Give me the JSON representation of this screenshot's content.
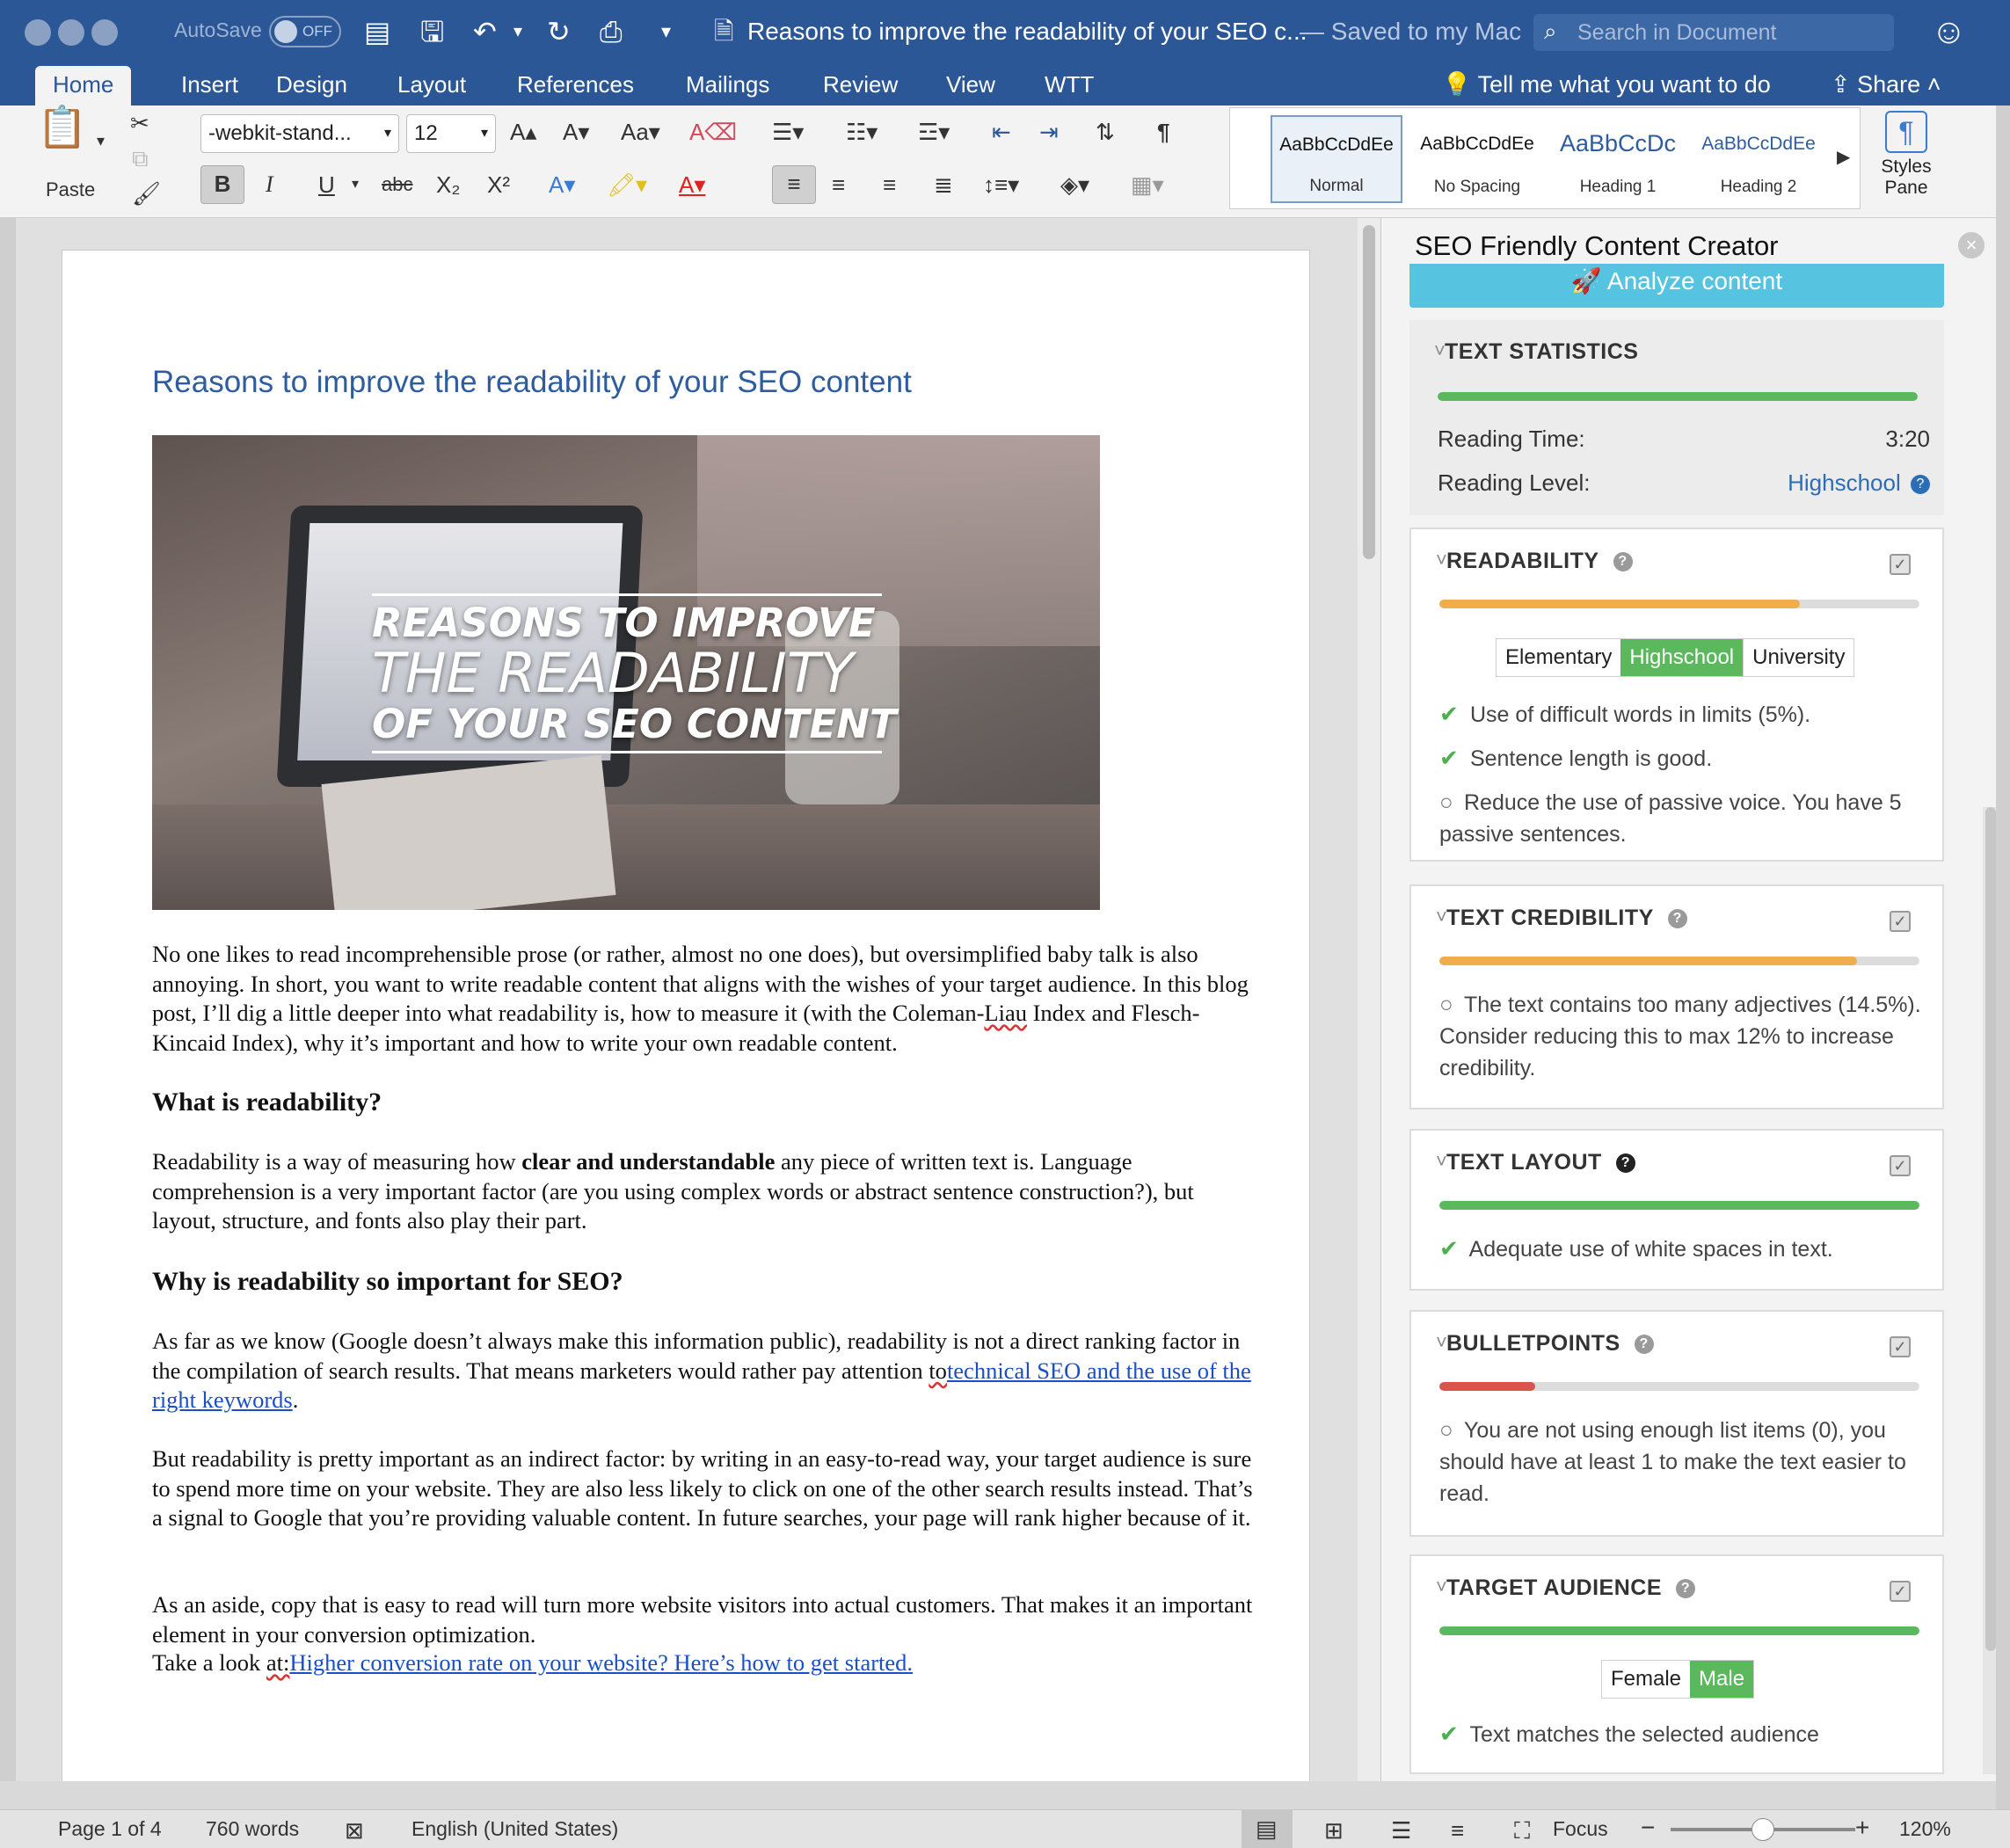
{
  "titlebar": {
    "autosave_label": "AutoSave",
    "autosave_state": "OFF",
    "doc_title": "Reasons to improve the readability of your SEO c...",
    "saved_status": "— Saved to my Mac",
    "search_placeholder": "Search in Document"
  },
  "tabs": [
    "Home",
    "Insert",
    "Design",
    "Layout",
    "References",
    "Mailings",
    "Review",
    "View",
    "WTT"
  ],
  "tell_me": "Tell me what you want to do",
  "share_label": "Share",
  "ribbon": {
    "paste_label": "Paste",
    "font_name": "-webkit-stand...",
    "font_size": "12",
    "bold": "B",
    "italic": "I",
    "underline": "U",
    "strikethrough": "abc",
    "subscript": "X₂",
    "superscript": "X²",
    "styles": [
      {
        "sample": "AaBbCcDdEe",
        "name": "Normal"
      },
      {
        "sample": "AaBbCcDdEe",
        "name": "No Spacing"
      },
      {
        "sample": "AaBbCcDc",
        "name": "Heading 1"
      },
      {
        "sample": "AaBbCcDdEe",
        "name": "Heading 2"
      }
    ],
    "styles_pane_label": "Styles Pane"
  },
  "document": {
    "heading": "Reasons to improve the readability of your SEO content",
    "hero": {
      "line1": "REASONS TO IMPROVE",
      "line2": "THE READABILITY",
      "line3": "OF YOUR SEO CONTENT"
    },
    "p1_a": "No one likes to read incomprehensible prose (or rather, almost no one does), but oversimplified baby talk is also annoying. In short, you want to write readable content that aligns with the wishes of your target audience. In this blog post, I’ll dig a little deeper into what readability is, how to measure it (with the Coleman-",
    "p1_squig": "Liau",
    "p1_b": " Index and Flesch-Kincaid Index), why it’s important and how to write your own readable content.",
    "h_what": "What is readability?",
    "p2_a": "Readability is a way of measuring how ",
    "p2_bold": "clear and understandable",
    "p2_b": " any piece of written text is. Language comprehension is a very important factor (are you using complex words or abstract sentence construction?), but layout, structure, and fonts also play their part.",
    "h_why": "Why is readability so important for SEO?",
    "p3_a": "As far as we know (Google doesn’t always make this information public), readability is not a direct ranking factor in the compilation of search results. That means marketers would rather pay attention ",
    "p3_squig": "to",
    "p3_link": "technical SEO and the use of the right keywords",
    "p3_end": ".",
    "p4": "But readability is pretty important as an indirect factor: by writing in an easy-to-read way, your target audience is sure to spend more time on your website. They are also less likely to click on one of the other search results instead. That’s a signal to Google that you’re providing valuable content. In future searches, your page will rank higher because of it.",
    "p5": "As an aside, copy that is easy to read will turn more website visitors into actual customers. That makes it an important element in your conversion optimization.",
    "p6_a": "Take a look ",
    "p6_squig": "at:",
    "p6_link": "Higher conversion rate on your website? Here’s how to get started."
  },
  "pane": {
    "title": "SEO Friendly Content Creator",
    "analyze_label": "Analyze content",
    "stats": {
      "header": "TEXT STATISTICS",
      "bar_fill": 1.0,
      "reading_time_label": "Reading Time:",
      "reading_time_value": "3:20",
      "reading_level_label": "Reading Level:",
      "reading_level_value": "Highschool"
    },
    "readability": {
      "header": "READABILITY",
      "bar_fill": 0.75,
      "levels": [
        "Elementary",
        "Highschool",
        "University"
      ],
      "selected_level": "Highschool",
      "items": [
        {
          "status": "ok",
          "text": "Use of difficult words in limits (5%)."
        },
        {
          "status": "ok",
          "text": "Sentence length is good."
        },
        {
          "status": "todo",
          "text": "Reduce the use of passive voice. You have 5 passive sentences."
        }
      ]
    },
    "credibility": {
      "header": "TEXT CREDIBILITY",
      "bar_fill": 0.87,
      "items": [
        {
          "status": "todo",
          "text": "The text contains too many adjectives (14.5%). Consider reducing this to max 12% to increase credibility."
        }
      ]
    },
    "layout": {
      "header": "TEXT LAYOUT",
      "bar_fill": 1.0,
      "items": [
        {
          "status": "ok",
          "text": "Adequate use of white spaces in text."
        }
      ]
    },
    "bulletpoints": {
      "header": "BULLETPOINTS",
      "bar_fill": 0.2,
      "items": [
        {
          "status": "todo",
          "text": "You are not using enough list items (0), you should have at least 1 to make the text easier to read."
        }
      ]
    },
    "audience": {
      "header": "TARGET AUDIENCE",
      "bar_fill": 1.0,
      "options": [
        "Female",
        "Male"
      ],
      "selected": "Male",
      "items": [
        {
          "status": "ok",
          "text": "Text matches the selected audience"
        }
      ]
    }
  },
  "statusbar": {
    "page": "Page 1 of 4",
    "words": "760 words",
    "language": "English (United States)",
    "focus_label": "Focus",
    "zoom": "120%",
    "zoom_fraction": 0.5
  },
  "colors": {
    "title_blue": "#2b5797",
    "good_green": "#5cb85c",
    "warn_orange": "#f0ad4e",
    "bad_red": "#d9534f",
    "analyze_cyan": "#56c4e1",
    "link_blue": "#1a4fc8"
  },
  "icons": {
    "save": "save-icon",
    "undo": "undo-icon",
    "redo": "redo-icon",
    "print": "print-icon",
    "search": "search-icon",
    "lightbulb": "lightbulb-icon",
    "share": "share-icon",
    "rocket": "rocket-icon",
    "check": "check-icon",
    "circle": "circle-icon",
    "help": "help-icon",
    "close": "close-icon"
  }
}
